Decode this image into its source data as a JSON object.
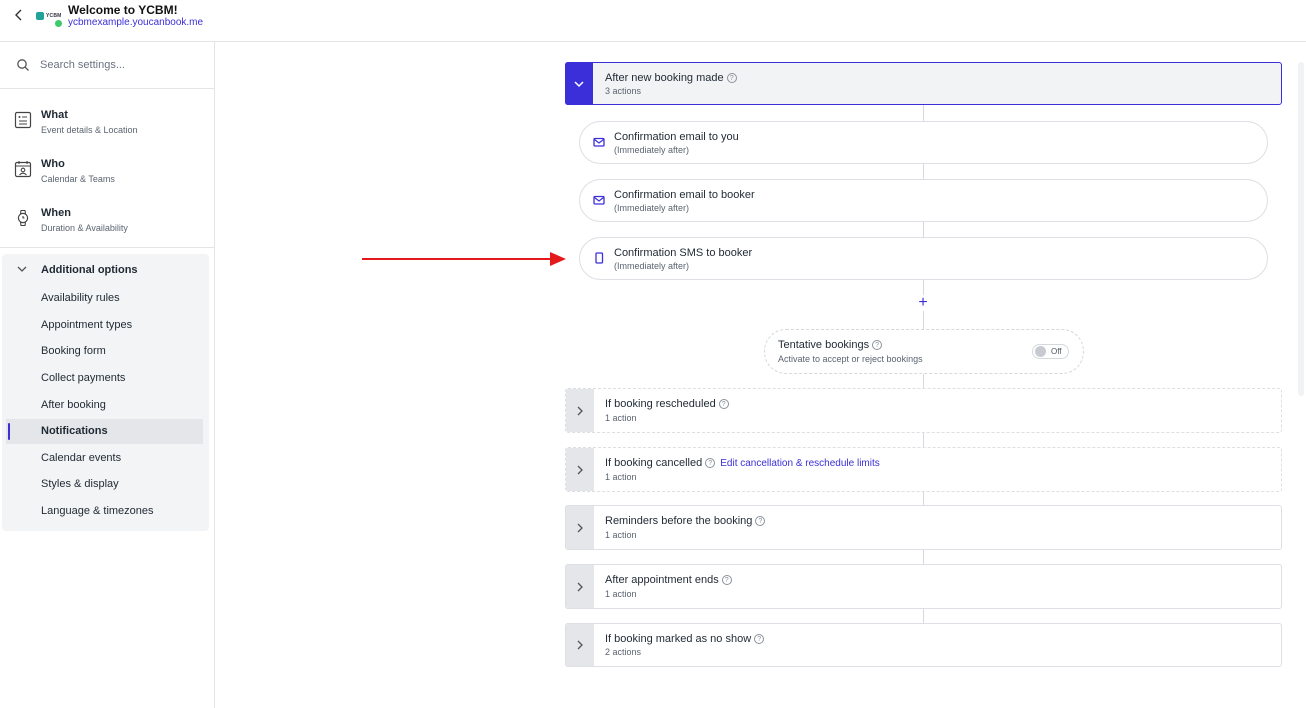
{
  "header": {
    "title": "Welcome to YCBM!",
    "url": "ycbmexample.youcanbook.me",
    "logo_text": "YCBM"
  },
  "sidebar": {
    "search_placeholder": "Search settings...",
    "main_items": [
      {
        "title": "What",
        "subtitle": "Event details & Location",
        "icon": "document-icon"
      },
      {
        "title": "Who",
        "subtitle": "Calendar & Teams",
        "icon": "calendar-person-icon"
      },
      {
        "title": "When",
        "subtitle": "Duration & Availability",
        "icon": "watch-icon"
      }
    ],
    "additional": {
      "title": "Additional options",
      "items": [
        "Availability rules",
        "Appointment types",
        "Booking form",
        "Collect payments",
        "After booking",
        "Notifications",
        "Calendar events",
        "Styles & display",
        "Language & timezones"
      ],
      "active_index": 5
    }
  },
  "main": {
    "new_booking": {
      "title": "After new booking made",
      "subtitle": "3 actions",
      "actions": [
        {
          "title": "Confirmation email to you",
          "subtitle": "(Immediately after)",
          "icon": "envelope-icon"
        },
        {
          "title": "Confirmation email to booker",
          "subtitle": "(Immediately after)",
          "icon": "envelope-icon"
        },
        {
          "title": "Confirmation SMS to booker",
          "subtitle": "(Immediately after)",
          "icon": "phone-icon"
        }
      ]
    },
    "add_symbol": "+",
    "tentative": {
      "title": "Tentative bookings",
      "subtitle": "Activate to accept or reject bookings",
      "toggle_label": "Off"
    },
    "sections": [
      {
        "title": "If booking rescheduled",
        "subtitle": "1 action"
      },
      {
        "title": "If booking cancelled",
        "subtitle": "1 action",
        "link": "Edit cancellation & reschedule limits"
      },
      {
        "title": "Reminders before the booking",
        "subtitle": "1 action"
      },
      {
        "title": "After appointment ends",
        "subtitle": "1 action"
      },
      {
        "title": "If booking marked as no show",
        "subtitle": "2 actions"
      }
    ],
    "help_glyph": "?"
  },
  "colors": {
    "accent": "#3b2fd9",
    "arrow": "#e3191c",
    "sidebar_active_bg": "#e4e6ea"
  }
}
